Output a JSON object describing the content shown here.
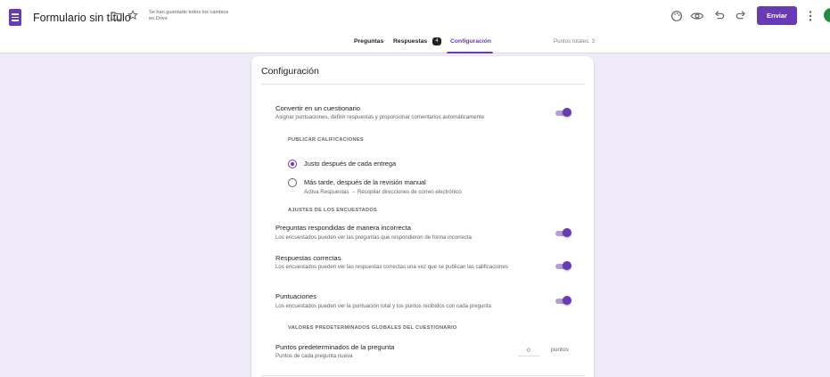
{
  "header": {
    "title": "Formulario sin título",
    "save_status": "Se han guardado todos los cambios en Drive",
    "send_label": "Enviar",
    "icons": [
      "forms-doc-icon",
      "folder-icon",
      "star-icon",
      "palette-icon",
      "eye-icon",
      "undo-icon",
      "redo-icon",
      "more-vert-icon"
    ],
    "accent_color": "#673ab7"
  },
  "tabs": {
    "questions": "Preguntas",
    "responses": "Respuestas",
    "responses_count": "4",
    "settings": "Configuración",
    "total_points": "Puntos totales: 3"
  },
  "settings": {
    "title": "Configuración",
    "quiz": {
      "title": "Convertir en un cuestionario",
      "desc": "Asignar puntuaciones, definir respuestas y proporcionar comentarios automáticamente",
      "enabled": true
    },
    "publish_section": "PUBLICAR CALIFICACIONES",
    "publish_options": [
      {
        "label": "Justo después de cada entrega",
        "selected": true
      },
      {
        "label": "Más tarde, después de la revisión manual",
        "sub": "Activa Respuestas → Recopilar direcciones de correo electrónico",
        "selected": false
      }
    ],
    "respondent_section": "AJUSTES DE LOS ENCUESTADOS",
    "respondent_settings": [
      {
        "title": "Preguntas respondidas de manera incorrecta",
        "desc": "Los encuestados pueden ver las preguntas que respondieron de forma incorrecta",
        "enabled": true
      },
      {
        "title": "Respuestas correctas",
        "desc": "Los encuestados pueden ver las respuestas correctas una vez que se publican las calificaciones",
        "enabled": true
      },
      {
        "title": "Puntuaciones",
        "desc": "Los encuestados pueden ver la puntuación total y los puntos recibidos con cada pregunta",
        "enabled": true
      }
    ],
    "defaults_section": "VALORES PREDETERMINADOS GLOBALES DEL CUESTIONARIO",
    "default_points": {
      "title": "Puntos predeterminados de la pregunta",
      "desc": "Puntos de cada pregunta nueva",
      "value": "0",
      "unit": "puntos"
    }
  }
}
